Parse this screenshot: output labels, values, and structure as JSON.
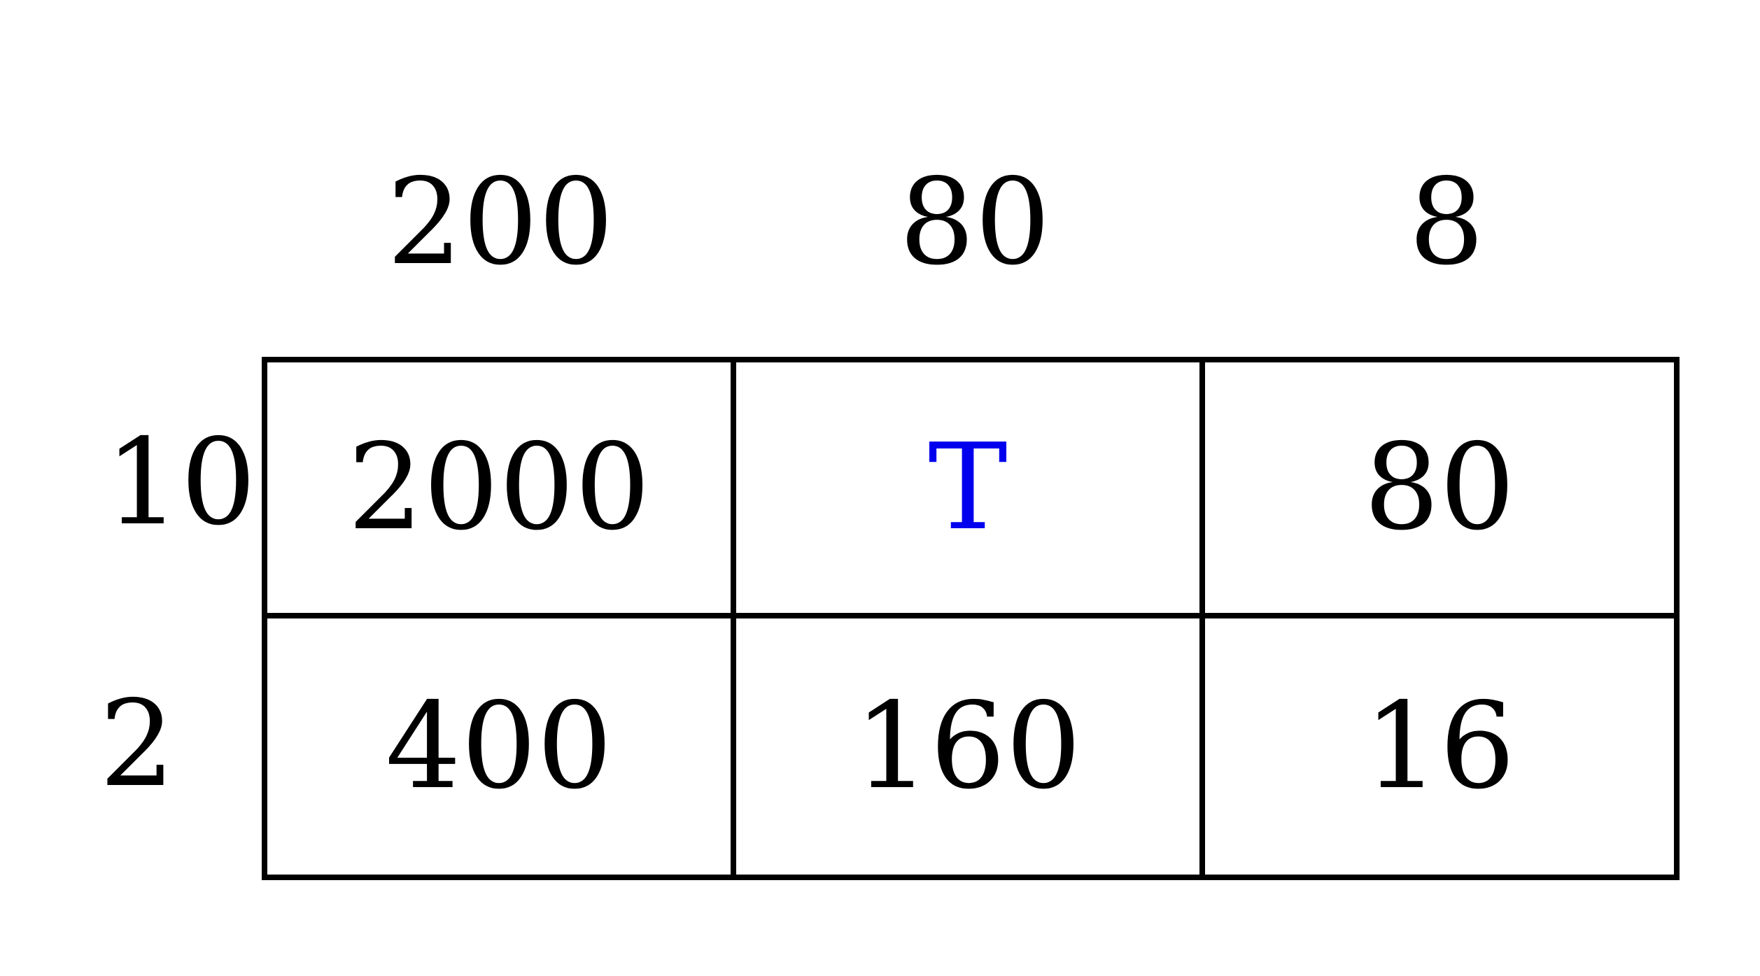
{
  "column_headers": [
    "200",
    "80",
    "8"
  ],
  "row_headers": [
    "10",
    "2"
  ],
  "cells": [
    [
      "2000",
      "T",
      "80"
    ],
    [
      "400",
      "160",
      "16"
    ]
  ],
  "colors": {
    "text": "#000000",
    "highlight": "#0000ee",
    "grid_line": "#000000"
  }
}
